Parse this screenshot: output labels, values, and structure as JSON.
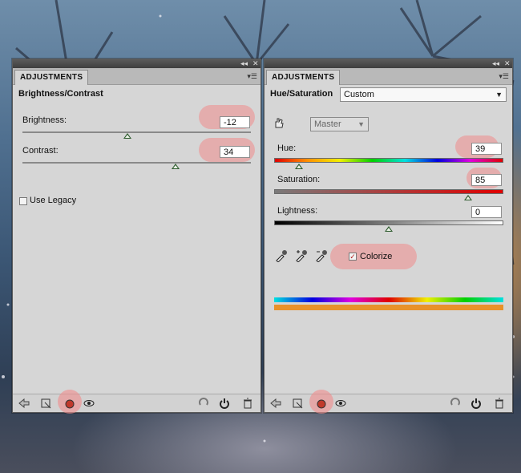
{
  "window": {
    "collapse_icon": "◂◂",
    "close_icon": "✕",
    "menu_icon": "▾☰"
  },
  "left_panel": {
    "tab": "ADJUSTMENTS",
    "title": "Brightness/Contrast",
    "brightness": {
      "label": "Brightness:",
      "value": "-12",
      "slider_fraction": 0.46
    },
    "contrast": {
      "label": "Contrast:",
      "value": "34",
      "slider_fraction": 0.67
    },
    "use_legacy": {
      "label": "Use Legacy",
      "checked": false
    }
  },
  "right_panel": {
    "tab": "ADJUSTMENTS",
    "title": "Hue/Saturation",
    "preset": "Custom",
    "channel": "Master",
    "hue": {
      "label": "Hue:",
      "value": "39",
      "slider_fraction": 0.11
    },
    "saturation": {
      "label": "Saturation:",
      "value": "85",
      "slider_fraction": 0.85
    },
    "lightness": {
      "label": "Lightness:",
      "value": "0",
      "slider_fraction": 0.5
    },
    "colorize": {
      "label": "Colorize",
      "checked": true,
      "check_glyph": "✓"
    },
    "colorize_color": "#e8922a"
  },
  "bottom_icons": [
    "back-arrow-icon",
    "clip-to-layer-icon",
    "visibility-dot-icon",
    "eye-icon",
    "reset-view-icon",
    "reset-icon",
    "trash-icon"
  ]
}
